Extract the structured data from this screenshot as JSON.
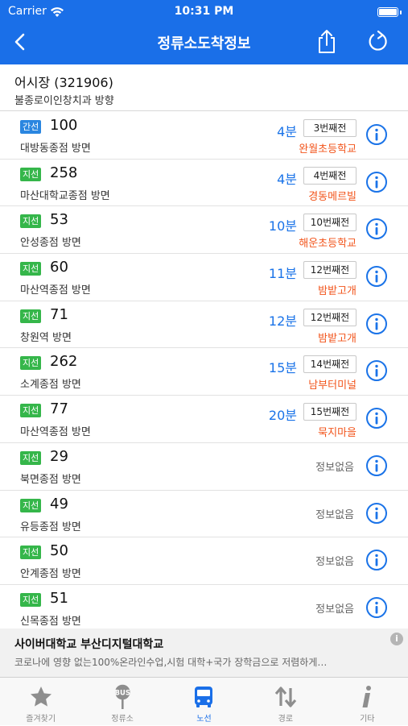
{
  "status_bar": {
    "carrier": "Carrier",
    "time": "10:31 PM"
  },
  "header": {
    "title": "정류소도착정보"
  },
  "stop": {
    "name": "어시장 (321906)",
    "direction": "불종로이인창치과 방향"
  },
  "routes": [
    {
      "type": "간선",
      "type_color": "#2a86e0",
      "number": "100",
      "direction": "대방동종점 방면",
      "minutes": "4분",
      "stops_before": "3번째전",
      "current_stop": "완월초등학교"
    },
    {
      "type": "지선",
      "type_color": "#35b64a",
      "number": "258",
      "direction": "마산대학교종점 방면",
      "minutes": "4분",
      "stops_before": "4번째전",
      "current_stop": "경동메르빌"
    },
    {
      "type": "지선",
      "type_color": "#35b64a",
      "number": "53",
      "direction": "안성종점 방면",
      "minutes": "10분",
      "stops_before": "10번째전",
      "current_stop": "해운초등학교"
    },
    {
      "type": "지선",
      "type_color": "#35b64a",
      "number": "60",
      "direction": "마산역종점 방면",
      "minutes": "11분",
      "stops_before": "12번째전",
      "current_stop": "밤밭고개"
    },
    {
      "type": "지선",
      "type_color": "#35b64a",
      "number": "71",
      "direction": "창원역 방면",
      "minutes": "12분",
      "stops_before": "12번째전",
      "current_stop": "밤밭고개"
    },
    {
      "type": "지선",
      "type_color": "#35b64a",
      "number": "262",
      "direction": "소계종점 방면",
      "minutes": "15분",
      "stops_before": "14번째전",
      "current_stop": "남부터미널"
    },
    {
      "type": "지선",
      "type_color": "#35b64a",
      "number": "77",
      "direction": "마산역종점 방면",
      "minutes": "20분",
      "stops_before": "15번째전",
      "current_stop": "묵지마을"
    },
    {
      "type": "지선",
      "type_color": "#35b64a",
      "number": "29",
      "direction": "북면종점 방면",
      "no_info": "정보없음"
    },
    {
      "type": "지선",
      "type_color": "#35b64a",
      "number": "49",
      "direction": "유등종점 방면",
      "no_info": "정보없음"
    },
    {
      "type": "지선",
      "type_color": "#35b64a",
      "number": "50",
      "direction": "안계종점 방면",
      "no_info": "정보없음"
    },
    {
      "type": "지선",
      "type_color": "#35b64a",
      "number": "51",
      "direction": "신목종점 방면",
      "no_info": "정보없음"
    }
  ],
  "ad": {
    "title": "사이버대학교 부산디지털대학교",
    "body": "코로나에 영향 없는100%온라인수업,시험 대학+국가 장학금으로 저렴하게…"
  },
  "tabbar": [
    {
      "label": "즐겨찾기",
      "icon": "star-icon",
      "active": false
    },
    {
      "label": "정류소",
      "icon": "bus-stop-icon",
      "active": false
    },
    {
      "label": "노선",
      "icon": "bus-icon",
      "active": true
    },
    {
      "label": "경로",
      "icon": "swap-arrows-icon",
      "active": false
    },
    {
      "label": "기타",
      "icon": "info-i-icon",
      "active": false
    }
  ],
  "colors": {
    "primary": "#1a6fe8",
    "minutes": "#1a73e8",
    "current_stop": "#f2541b",
    "feeder_badge": "#35b64a",
    "trunk_badge": "#2a86e0"
  }
}
